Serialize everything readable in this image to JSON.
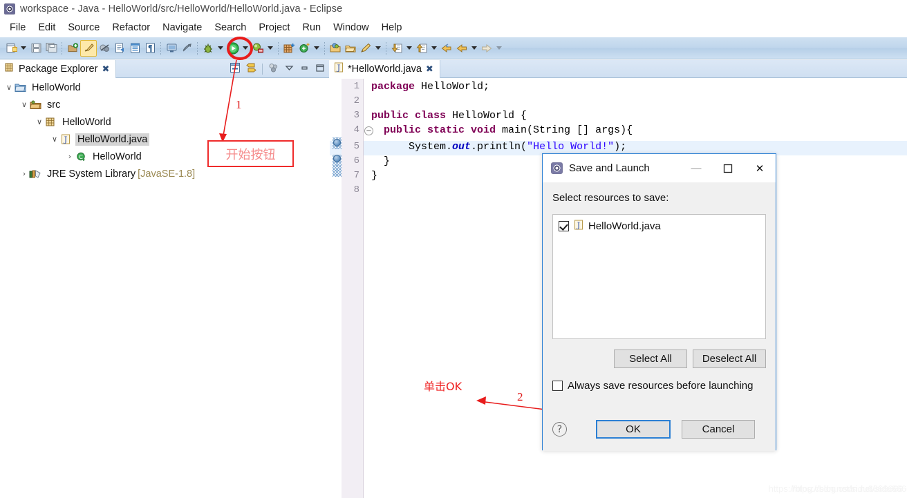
{
  "window": {
    "title": "workspace - Java - HelloWorld/src/HelloWorld/HelloWorld.java - Eclipse",
    "icon": "eclipse-icon"
  },
  "menubar": {
    "items": [
      {
        "label": "File"
      },
      {
        "label": "Edit"
      },
      {
        "label": "Source"
      },
      {
        "label": "Refactor"
      },
      {
        "label": "Navigate"
      },
      {
        "label": "Search"
      },
      {
        "label": "Project"
      },
      {
        "label": "Run"
      },
      {
        "label": "Window"
      },
      {
        "label": "Help"
      }
    ]
  },
  "toolbar": {
    "items": [
      {
        "name": "new-wizard-icon",
        "kind": "icon"
      },
      {
        "name": "new-wizard-dropdown",
        "kind": "caret"
      },
      {
        "name": "save-icon",
        "kind": "icon"
      },
      {
        "name": "save-all-icon",
        "kind": "icon"
      },
      {
        "name": "separator",
        "kind": "sep"
      },
      {
        "name": "new-java-package-icon",
        "kind": "icon"
      },
      {
        "name": "toggle-mark-occurrences-icon",
        "kind": "icon-selected"
      },
      {
        "name": "skip-breakpoints-icon",
        "kind": "icon"
      },
      {
        "name": "open-task-icon",
        "kind": "icon"
      },
      {
        "name": "open-type-icon",
        "kind": "icon"
      },
      {
        "name": "show-whitespace-icon",
        "kind": "icon"
      },
      {
        "name": "separator",
        "kind": "sep"
      },
      {
        "name": "new-java-console-icon",
        "kind": "icon"
      },
      {
        "name": "toggle-breadcrumb-icon",
        "kind": "icon"
      },
      {
        "name": "separator",
        "kind": "sep"
      },
      {
        "name": "debug-icon",
        "kind": "icon"
      },
      {
        "name": "debug-dropdown",
        "kind": "caret"
      },
      {
        "name": "run-icon",
        "kind": "icon-run"
      },
      {
        "name": "run-dropdown",
        "kind": "caret"
      },
      {
        "name": "external-tools-icon",
        "kind": "icon"
      },
      {
        "name": "external-tools-dropdown",
        "kind": "caret"
      },
      {
        "name": "separator",
        "kind": "sep"
      },
      {
        "name": "new-java-project-icon",
        "kind": "icon"
      },
      {
        "name": "new-class-icon",
        "kind": "icon"
      },
      {
        "name": "new-class-dropdown",
        "kind": "caret"
      },
      {
        "name": "separator",
        "kind": "sep"
      },
      {
        "name": "open-package-icon",
        "kind": "icon"
      },
      {
        "name": "open-folder-icon",
        "kind": "icon"
      },
      {
        "name": "annotate-icon",
        "kind": "icon"
      },
      {
        "name": "annotate-dropdown",
        "kind": "caret"
      },
      {
        "name": "separator",
        "kind": "sep"
      },
      {
        "name": "previous-annotation-icon",
        "kind": "icon"
      },
      {
        "name": "previous-dropdown",
        "kind": "caret"
      },
      {
        "name": "next-annotation-icon",
        "kind": "icon"
      },
      {
        "name": "next-dropdown",
        "kind": "caret"
      },
      {
        "name": "back-icon",
        "kind": "icon"
      },
      {
        "name": "back-history-icon",
        "kind": "icon"
      },
      {
        "name": "back-dropdown",
        "kind": "caret"
      },
      {
        "name": "forward-icon",
        "kind": "icon"
      },
      {
        "name": "forward-dropdown",
        "kind": "caret-dim"
      }
    ]
  },
  "package_explorer": {
    "tab_label": "Package Explorer",
    "tab_close": "✖",
    "view_tools": [
      {
        "name": "collapse-all-icon"
      },
      {
        "name": "link-with-editor-icon"
      },
      {
        "name": "focus-on-active-task-icon"
      },
      {
        "name": "view-menu-icon"
      },
      {
        "name": "minimize-view-icon"
      },
      {
        "name": "maximize-view-icon"
      }
    ],
    "tree": [
      {
        "label": "HelloWorld",
        "indent": 0,
        "twisty": "∨",
        "icon": "java-project-icon",
        "selected": false,
        "suffix": ""
      },
      {
        "label": "src",
        "indent": 1,
        "twisty": "∨",
        "icon": "source-folder-icon",
        "selected": false,
        "suffix": ""
      },
      {
        "label": "HelloWorld",
        "indent": 2,
        "twisty": "∨",
        "icon": "package-icon",
        "selected": false,
        "suffix": ""
      },
      {
        "label": "HelloWorld.java",
        "indent": 3,
        "twisty": "∨",
        "icon": "java-file-icon",
        "selected": true,
        "suffix": ""
      },
      {
        "label": "HelloWorld",
        "indent": 4,
        "twisty": "›",
        "icon": "java-class-icon",
        "selected": false,
        "suffix": ""
      },
      {
        "label": "JRE System Library",
        "indent": 1,
        "twisty": "›",
        "icon": "jre-library-icon",
        "selected": false,
        "suffix": " [JavaSE-1.8]"
      }
    ]
  },
  "editor": {
    "tab_label": "*HelloWorld.java",
    "tab_close": "✖",
    "tab_icon": "java-file-icon",
    "lines": [
      {
        "no": "1",
        "fold": false,
        "highlight": false,
        "segments": [
          {
            "t": "package ",
            "c": "kw"
          },
          {
            "t": "HelloWorld;",
            "c": ""
          }
        ]
      },
      {
        "no": "2",
        "fold": false,
        "highlight": false,
        "segments": []
      },
      {
        "no": "3",
        "fold": false,
        "highlight": false,
        "segments": [
          {
            "t": "public class ",
            "c": "kw"
          },
          {
            "t": "HelloWorld {",
            "c": ""
          }
        ]
      },
      {
        "no": "4",
        "fold": true,
        "highlight": false,
        "segments": [
          {
            "t": "  ",
            "c": ""
          },
          {
            "t": "public static void ",
            "c": "kw"
          },
          {
            "t": "main(String [] args){",
            "c": ""
          }
        ]
      },
      {
        "no": "5",
        "fold": false,
        "highlight": true,
        "segments": [
          {
            "t": "      System.",
            "c": ""
          },
          {
            "t": "out",
            "c": "fld"
          },
          {
            "t": ".println(",
            "c": ""
          },
          {
            "t": "\"Hello World!\"",
            "c": "str"
          },
          {
            "t": ");",
            "c": ""
          }
        ]
      },
      {
        "no": "6",
        "fold": false,
        "highlight": false,
        "segments": [
          {
            "t": "  }",
            "c": ""
          }
        ]
      },
      {
        "no": "7",
        "fold": false,
        "highlight": false,
        "segments": [
          {
            "t": "}",
            "c": ""
          }
        ]
      },
      {
        "no": "8",
        "fold": false,
        "highlight": false,
        "segments": []
      }
    ]
  },
  "dialog": {
    "title": "Save and Launch",
    "icon": "eclipse-icon",
    "window_buttons": {
      "minimize": "—",
      "maximize": "☐",
      "close": "✕"
    },
    "prompt": "Select resources to save:",
    "resources": [
      {
        "label": "HelloWorld.java",
        "checked": true,
        "icon": "java-file-icon"
      }
    ],
    "select_all_label": "Select All",
    "deselect_all_label": "Deselect All",
    "always_save_label": "Always save resources before launching",
    "always_save_checked": false,
    "help_label": "?",
    "ok_label": "OK",
    "cancel_label": "Cancel"
  },
  "annotations": {
    "run_button_callout": {
      "number": "1",
      "box_text": "开始按钮"
    },
    "ok_button_callout": {
      "number": "2",
      "text": "单击OK"
    },
    "color": "#ef2020"
  },
  "watermark": {
    "line1": "https://blog.csdn.net/sidu6666666",
    "line2": "https://blog.csdn.net/sidu66666666"
  }
}
